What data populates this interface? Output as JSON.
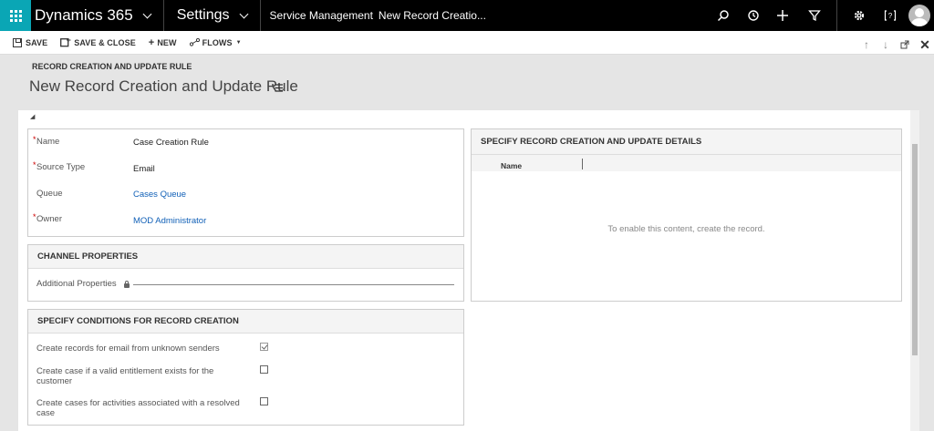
{
  "nav": {
    "app_name": "Dynamics 365",
    "area": "Settings",
    "breadcrumb_area": "Service Management",
    "breadcrumb_record": "New Record Creatio..."
  },
  "commands": {
    "save": "SAVE",
    "save_close": "SAVE & CLOSE",
    "new": "NEW",
    "flows": "FLOWS"
  },
  "header": {
    "entity": "RECORD CREATION AND UPDATE RULE",
    "title": "New Record Creation and Update Rule"
  },
  "general": {
    "name_label": "Name",
    "name_value": "Case Creation Rule",
    "source_label": "Source Type",
    "source_value": "Email",
    "queue_label": "Queue",
    "queue_value": "Cases Queue",
    "owner_label": "Owner",
    "owner_value": "MOD Administrator"
  },
  "channel": {
    "title": "CHANNEL PROPERTIES",
    "additional_label": "Additional Properties"
  },
  "conditions": {
    "title": "SPECIFY CONDITIONS FOR RECORD CREATION",
    "items": [
      {
        "label": "Create records for email from unknown senders",
        "checked": true
      },
      {
        "label_line1": "Create case if a valid entitlement exists for the",
        "label_line2": "customer",
        "checked": false
      },
      {
        "label_line1": "Create cases for activities associated with a resolved",
        "label_line2": "case",
        "checked": false
      }
    ]
  },
  "details": {
    "title": "SPECIFY RECORD CREATION AND UPDATE DETAILS",
    "column_name": "Name",
    "empty_message": "To enable this content, create the record."
  },
  "icons": {
    "search": "search-icon",
    "history": "history-icon",
    "add": "plus-icon",
    "filter": "filter-icon",
    "settings": "gear-icon",
    "help": "help-icon"
  },
  "colors": {
    "accent": "#0aa6b5",
    "link": "#1160b7",
    "required": "#cc0000"
  }
}
